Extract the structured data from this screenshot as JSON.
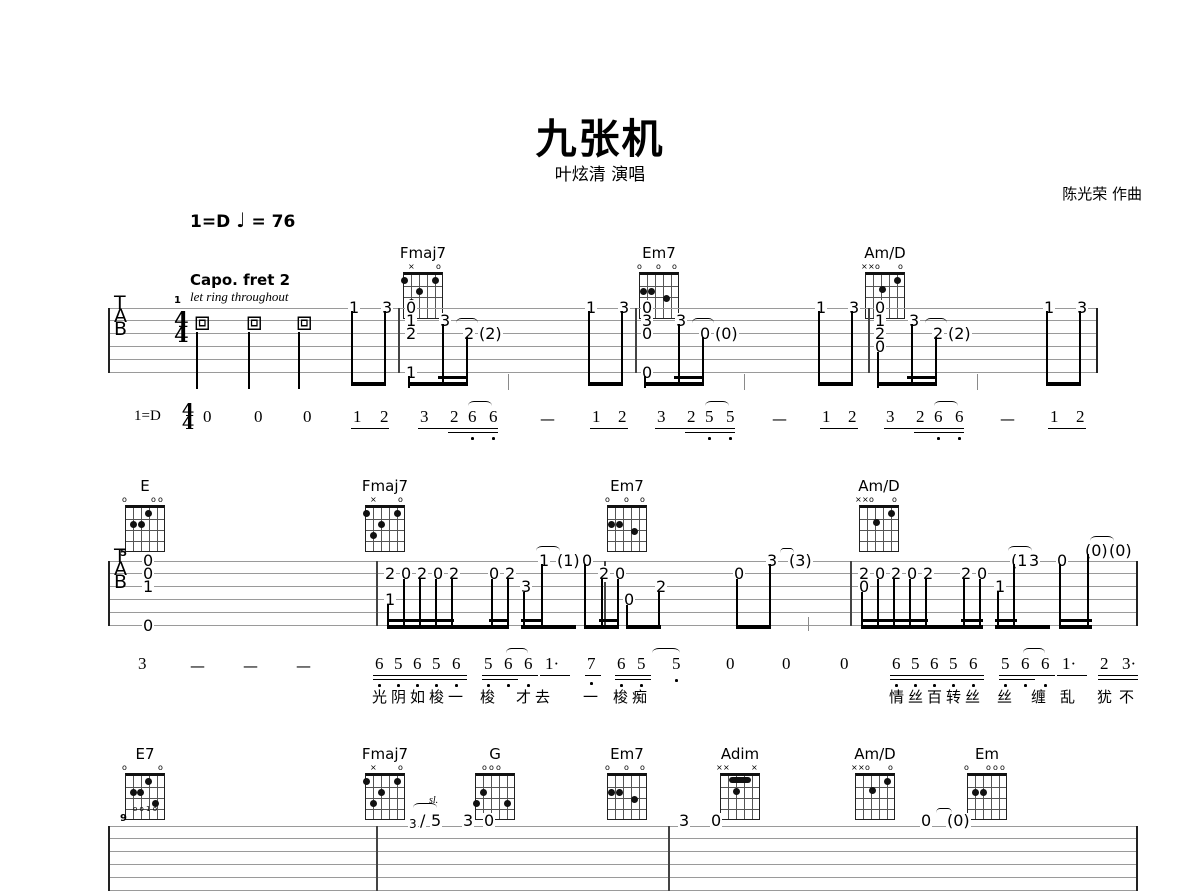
{
  "header": {
    "title": "九张机",
    "subtitle": "叶炫清 演唱",
    "composer": "陈光荣 作曲",
    "tempo_key": "1=D",
    "tempo_note": "♩",
    "tempo_eq": "= 76",
    "capo": "Capo. fret 2",
    "let_ring": "let ring throughout",
    "tab_label": [
      "T",
      "A",
      "B"
    ],
    "time_sig": [
      "4",
      "4"
    ]
  },
  "system1": {
    "measure_number": "1",
    "chords": [
      {
        "name": "Fmaj7",
        "markers": "x   o"
      },
      {
        "name": "Em7",
        "markers": "o  o o"
      },
      {
        "name": "Am/D",
        "markers": "xxo  o"
      }
    ],
    "tab_numbers": [
      "0",
      "1",
      "2",
      "1",
      "3",
      "2",
      "(2)",
      "1",
      "3",
      "0",
      "3",
      "0",
      "0",
      "3",
      "0",
      "(0)",
      "1",
      "3",
      "0",
      "1",
      "2",
      "0",
      "3",
      "2",
      "(2)",
      "1",
      "3"
    ],
    "rests": [
      "⧈",
      "⧈",
      "⧈"
    ],
    "jianpu_key": "1=D",
    "jianpu": [
      "0",
      "0",
      "0",
      "1",
      "2",
      "3",
      "2",
      "6",
      "6",
      "—",
      "1",
      "2",
      "3",
      "2",
      "5",
      "5",
      "—",
      "1",
      "2",
      "3",
      "2",
      "6",
      "6",
      "—",
      "1",
      "2"
    ]
  },
  "system2": {
    "measure_number": "5",
    "chords": [
      {
        "name": "E",
        "markers": "o   oo"
      },
      {
        "name": "Fmaj7",
        "markers": "x   o"
      },
      {
        "name": "Em7",
        "markers": "o  o o"
      },
      {
        "name": "Am/D",
        "markers": "xxo  o"
      }
    ],
    "tab_open": [
      "0",
      "0",
      "1",
      "0"
    ],
    "tab_m6": [
      "2",
      "0",
      "2",
      "0",
      "2",
      "1",
      "0",
      "2",
      "3",
      "1",
      "(1)",
      "0",
      "2",
      "0"
    ],
    "tab_m7": [
      "0",
      "2",
      "0",
      "3",
      "(3)"
    ],
    "tab_m8": [
      "2",
      "0",
      "2",
      "0",
      "2",
      "0",
      "0",
      "2",
      "0",
      "1",
      "(1)",
      "3",
      "0",
      "(0)"
    ],
    "jianpu_m5": [
      "3",
      "—",
      "—",
      "—"
    ],
    "jianpu_m6": [
      "6",
      "5",
      "6",
      "5",
      "6",
      "5",
      "6",
      "6",
      "1·",
      "7",
      "6",
      "5"
    ],
    "jianpu_m7": [
      "5",
      "0",
      "0",
      "0"
    ],
    "jianpu_m8": [
      "6",
      "5",
      "6",
      "5",
      "6",
      "5",
      "6",
      "6",
      "1·",
      "2",
      "3·"
    ],
    "lyrics_m6": [
      "光",
      "阴",
      "如",
      "梭",
      "一",
      "梭",
      "才",
      "去",
      "一",
      "梭",
      "痴"
    ],
    "lyrics_m8": [
      "情",
      "丝",
      "百",
      "转",
      "丝",
      "丝",
      "缠",
      "乱",
      "犹",
      "不"
    ]
  },
  "system3": {
    "measure_number": "9",
    "chords": [
      {
        "name": "E7",
        "markers": "o     o"
      },
      {
        "name": "Fmaj7",
        "markers": "x   o"
      },
      {
        "name": "G",
        "markers": "ooo"
      },
      {
        "name": "Em7",
        "markers": "o  o o"
      },
      {
        "name": "Adim",
        "markers": "xx    x"
      },
      {
        "name": "Am/D",
        "markers": "xxo  o"
      },
      {
        "name": "Em",
        "markers": "o  ooo"
      }
    ],
    "tab_numbers": [
      "3",
      "5",
      "3",
      "0",
      "3",
      "0",
      "0",
      "(0)"
    ],
    "slide_label": "sl."
  }
}
